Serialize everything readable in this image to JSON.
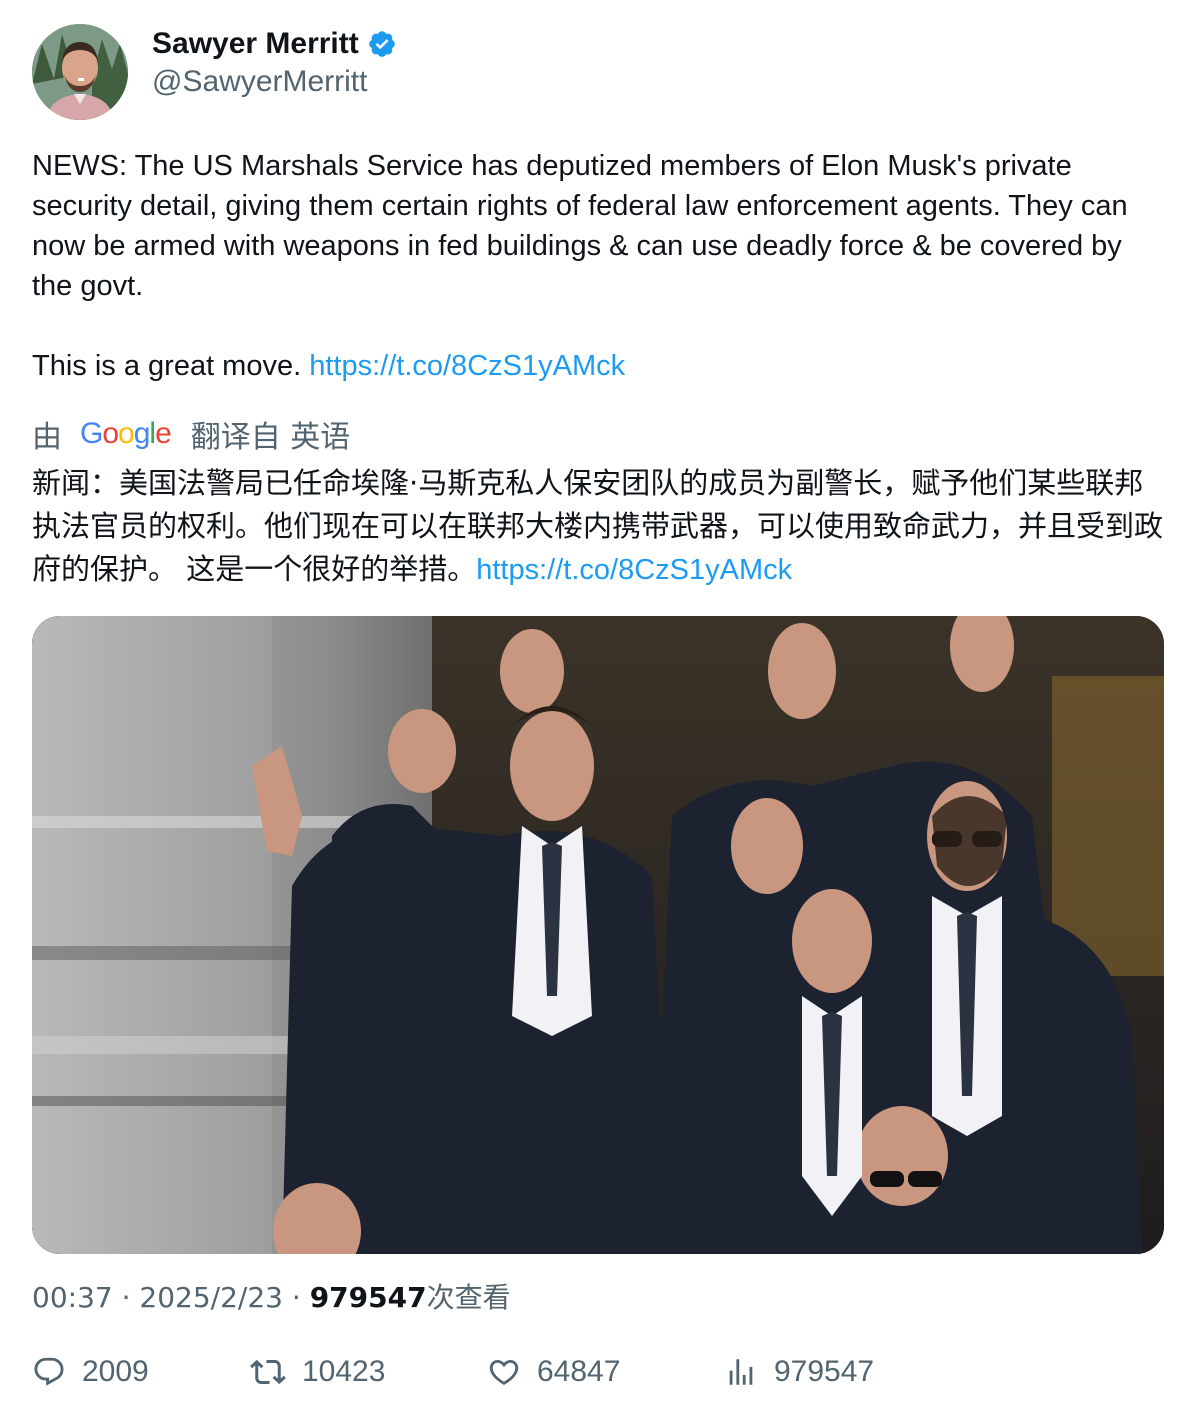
{
  "author": {
    "display_name": "Sawyer Merritt",
    "handle": "@SawyerMerritt",
    "verified": true
  },
  "tweet": {
    "text_main": "NEWS: The US Marshals Service has deputized members of Elon Musk's private security detail, giving them certain rights of federal law enforcement agents. They can now be armed with weapons in fed buildings & can use deadly force & be covered by the govt.\n\nThis is a great move. ",
    "link": "https://t.co/8CzS1yAMck"
  },
  "translation": {
    "by_label": "由",
    "provider": "Google",
    "from_label": "翻译自 英语",
    "text": "新闻：美国法警局已任命埃隆·马斯克私人保安团队的成员为副警长，赋予他们某些联邦执法官员的权利。他们现在可以在联邦大楼内携带武器，可以使用致命武力，并且受到政府的保护。 这是一个很好的举措。",
    "link": "https://t.co/8CzS1yAMck"
  },
  "meta": {
    "time": "00:37",
    "separator": " · ",
    "date": "2025/2/23",
    "views_count": "979547",
    "views_label": "次查看"
  },
  "actions": {
    "replies": "2009",
    "retweets": "10423",
    "likes": "64847",
    "views": "979547"
  },
  "colors": {
    "link": "#1d9bf0",
    "secondary_text": "#536471",
    "primary_text": "#0f1419",
    "verified": "#1d9bf0"
  }
}
